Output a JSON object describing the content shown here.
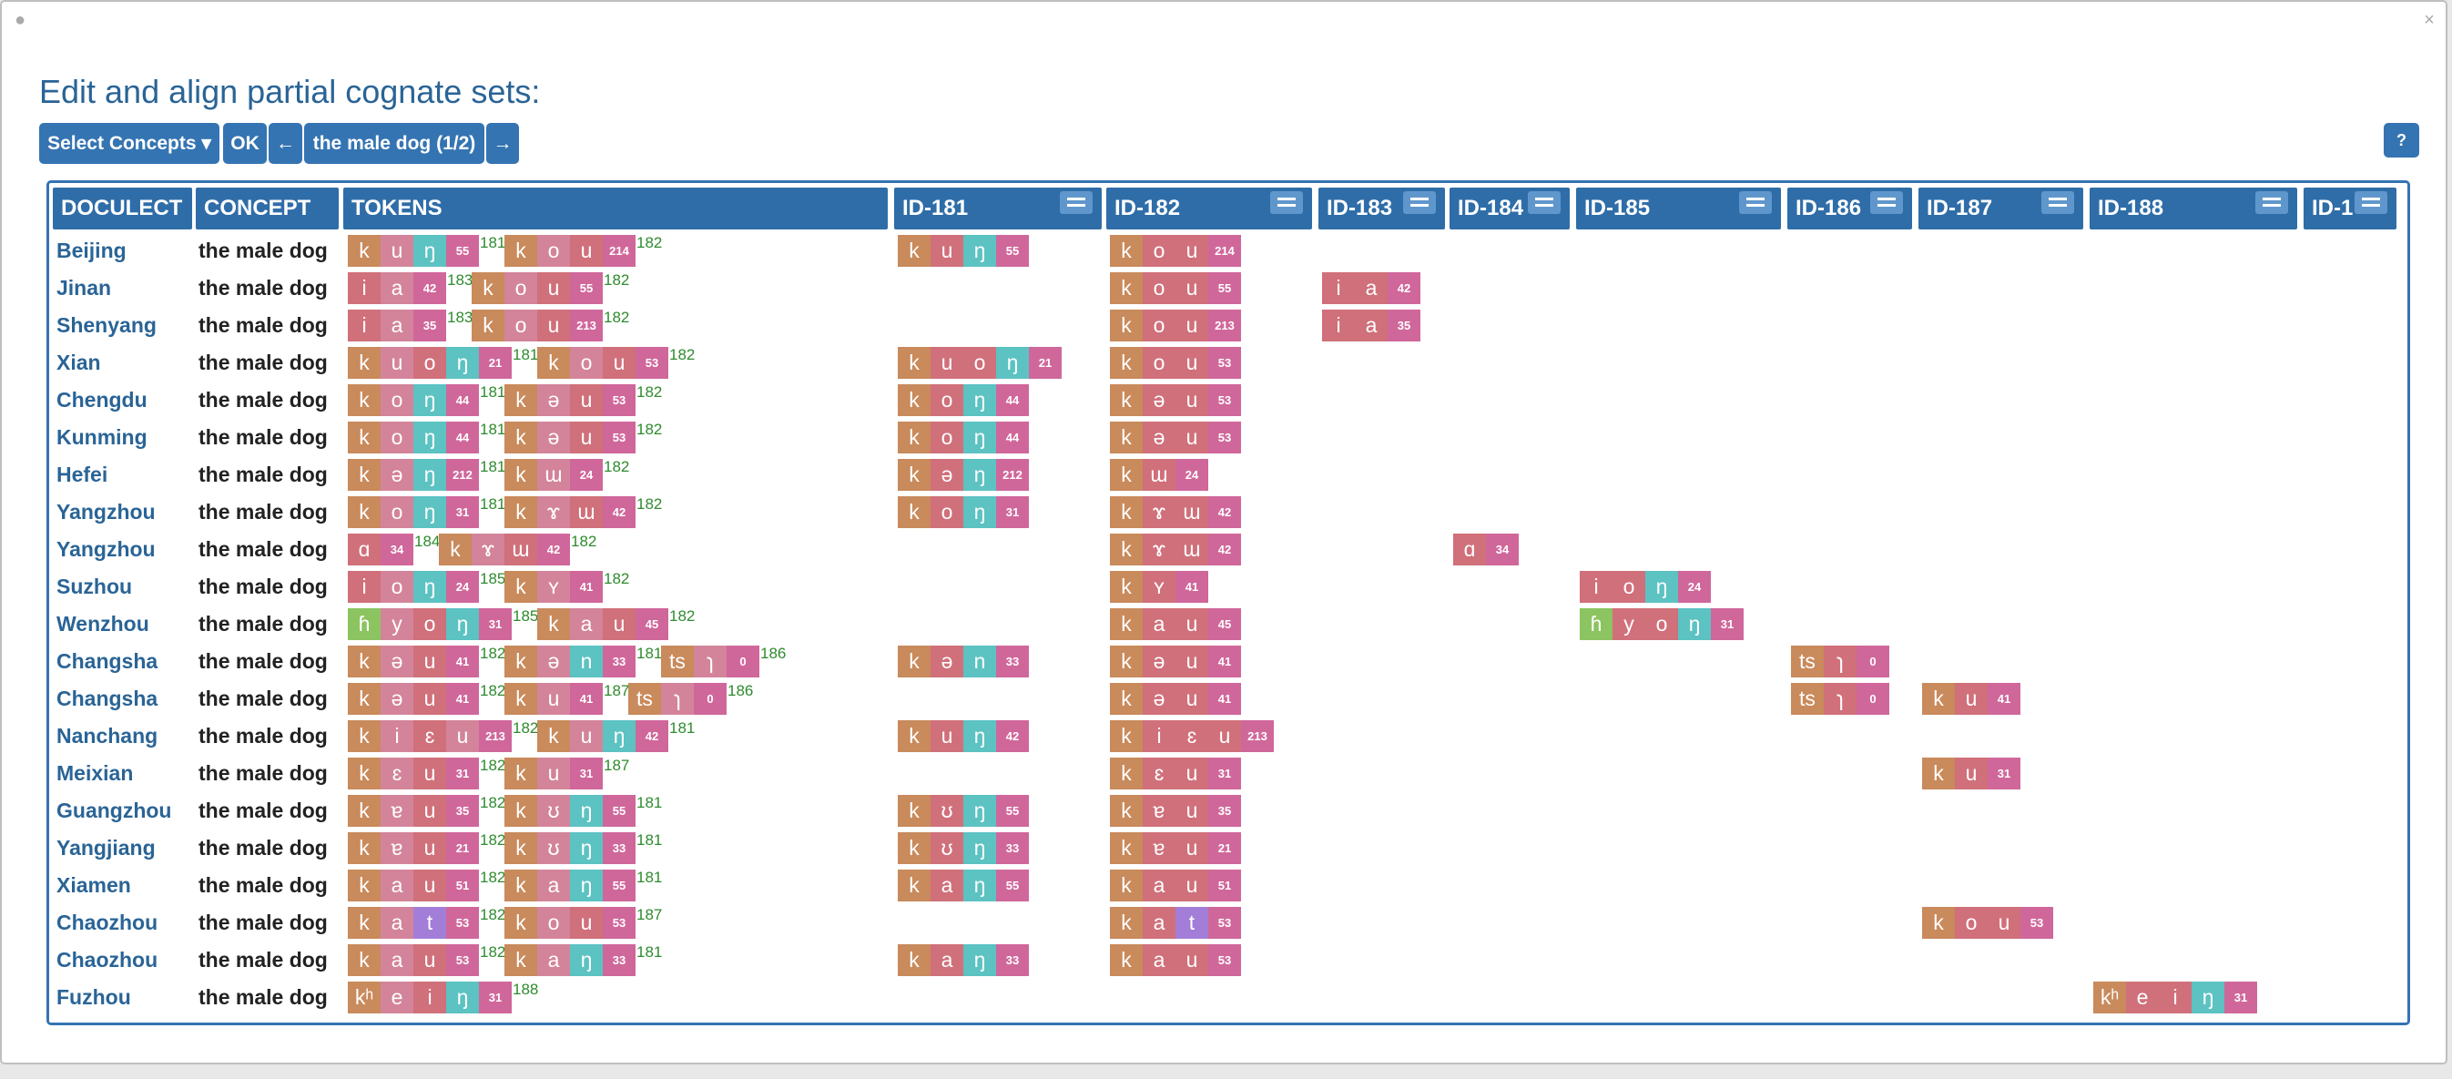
{
  "window": {
    "close_glyph": "×",
    "left_glyph": "●"
  },
  "title": "Edit and align partial cognate sets:",
  "toolbar": {
    "select_concepts": "Select Concepts ▾",
    "ok": "OK",
    "prev": "←",
    "current": "the male dog (1/2)",
    "next": "→",
    "help": "?"
  },
  "headers": [
    "DOCULECT",
    "CONCEPT",
    "TOKENS",
    "ID-181",
    "ID-182",
    "ID-183",
    "ID-184",
    "ID-185",
    "ID-186",
    "ID-187",
    "ID-188",
    "ID-1"
  ],
  "colors": {
    "consonant": "#c98a5c",
    "vowel": "#d0707a",
    "vowel_alt": "#d3849a",
    "nasal": "#5cc2c2",
    "tone": "#d0679a",
    "glottal": "#8bc460",
    "stop_t": "#a27ed8",
    "header": "#2f6da8",
    "button": "#3574b2"
  },
  "rows": [
    {
      "doculect": "Beijing",
      "concept": "the male dog",
      "morphemes": [
        {
          "tokens": [
            "k",
            "u",
            "ŋ",
            "55"
          ],
          "id": "181"
        },
        {
          "tokens": [
            "k",
            "o",
            "u",
            "214"
          ],
          "id": "182"
        }
      ],
      "cells": {
        "181": [
          "k",
          "u",
          "ŋ",
          "55"
        ],
        "182": [
          "k",
          "o",
          "u",
          "214"
        ]
      }
    },
    {
      "doculect": "Jinan",
      "concept": "the male dog",
      "morphemes": [
        {
          "tokens": [
            "i",
            "a",
            "42"
          ],
          "id": "183"
        },
        {
          "tokens": [
            "k",
            "o",
            "u",
            "55"
          ],
          "id": "182"
        }
      ],
      "cells": {
        "182": [
          "k",
          "o",
          "u",
          "55"
        ],
        "183": [
          "i",
          "a",
          "42"
        ]
      }
    },
    {
      "doculect": "Shenyang",
      "concept": "the male dog",
      "morphemes": [
        {
          "tokens": [
            "i",
            "a",
            "35"
          ],
          "id": "183"
        },
        {
          "tokens": [
            "k",
            "o",
            "u",
            "213"
          ],
          "id": "182"
        }
      ],
      "cells": {
        "182": [
          "k",
          "o",
          "u",
          "213"
        ],
        "183": [
          "i",
          "a",
          "35"
        ]
      }
    },
    {
      "doculect": "Xian",
      "concept": "the male dog",
      "morphemes": [
        {
          "tokens": [
            "k",
            "u",
            "o",
            "ŋ",
            "21"
          ],
          "id": "181"
        },
        {
          "tokens": [
            "k",
            "o",
            "u",
            "53"
          ],
          "id": "182"
        }
      ],
      "cells": {
        "181": [
          "k",
          "u",
          "o",
          "ŋ",
          "21"
        ],
        "182": [
          "k",
          "o",
          "u",
          "53"
        ]
      }
    },
    {
      "doculect": "Chengdu",
      "concept": "the male dog",
      "morphemes": [
        {
          "tokens": [
            "k",
            "o",
            "ŋ",
            "44"
          ],
          "id": "181"
        },
        {
          "tokens": [
            "k",
            "ə",
            "u",
            "53"
          ],
          "id": "182"
        }
      ],
      "cells": {
        "181": [
          "k",
          "o",
          "ŋ",
          "44"
        ],
        "182": [
          "k",
          "ə",
          "u",
          "53"
        ]
      }
    },
    {
      "doculect": "Kunming",
      "concept": "the male dog",
      "morphemes": [
        {
          "tokens": [
            "k",
            "o",
            "ŋ",
            "44"
          ],
          "id": "181"
        },
        {
          "tokens": [
            "k",
            "ə",
            "u",
            "53"
          ],
          "id": "182"
        }
      ],
      "cells": {
        "181": [
          "k",
          "o",
          "ŋ",
          "44"
        ],
        "182": [
          "k",
          "ə",
          "u",
          "53"
        ]
      }
    },
    {
      "doculect": "Hefei",
      "concept": "the male dog",
      "morphemes": [
        {
          "tokens": [
            "k",
            "ə",
            "ŋ",
            "212"
          ],
          "id": "181"
        },
        {
          "tokens": [
            "k",
            "ɯ",
            "24"
          ],
          "id": "182"
        }
      ],
      "cells": {
        "181": [
          "k",
          "ə",
          "ŋ",
          "212"
        ],
        "182": [
          "k",
          "ɯ",
          "24"
        ]
      }
    },
    {
      "doculect": "Yangzhou",
      "concept": "the male dog",
      "morphemes": [
        {
          "tokens": [
            "k",
            "o",
            "ŋ",
            "31"
          ],
          "id": "181"
        },
        {
          "tokens": [
            "k",
            "ɤ",
            "ɯ",
            "42"
          ],
          "id": "182"
        }
      ],
      "cells": {
        "181": [
          "k",
          "o",
          "ŋ",
          "31"
        ],
        "182": [
          "k",
          "ɤ",
          "ɯ",
          "42"
        ]
      }
    },
    {
      "doculect": "Yangzhou",
      "concept": "the male dog",
      "morphemes": [
        {
          "tokens": [
            "ɑ",
            "34"
          ],
          "id": "184"
        },
        {
          "tokens": [
            "k",
            "ɤ",
            "ɯ",
            "42"
          ],
          "id": "182"
        }
      ],
      "cells": {
        "182": [
          "k",
          "ɤ",
          "ɯ",
          "42"
        ],
        "184": [
          "ɑ",
          "34"
        ]
      }
    },
    {
      "doculect": "Suzhou",
      "concept": "the male dog",
      "morphemes": [
        {
          "tokens": [
            "i",
            "o",
            "ŋ",
            "24"
          ],
          "id": "185"
        },
        {
          "tokens": [
            "k",
            "ʏ",
            "41"
          ],
          "id": "182"
        }
      ],
      "cells": {
        "182": [
          "k",
          "ʏ",
          "41"
        ],
        "185": [
          "i",
          "o",
          "ŋ",
          "24"
        ]
      }
    },
    {
      "doculect": "Wenzhou",
      "concept": "the male dog",
      "morphemes": [
        {
          "tokens": [
            "ɦ",
            "y",
            "o",
            "ŋ",
            "31"
          ],
          "id": "185"
        },
        {
          "tokens": [
            "k",
            "a",
            "u",
            "45"
          ],
          "id": "182"
        }
      ],
      "cells": {
        "182": [
          "k",
          "a",
          "u",
          "45"
        ],
        "185": [
          "ɦ",
          "y",
          "o",
          "ŋ",
          "31"
        ]
      }
    },
    {
      "doculect": "Changsha",
      "concept": "the male dog",
      "morphemes": [
        {
          "tokens": [
            "k",
            "ə",
            "u",
            "41"
          ],
          "id": "182"
        },
        {
          "tokens": [
            "k",
            "ə",
            "n",
            "33"
          ],
          "id": "181"
        },
        {
          "tokens": [
            "ts",
            "ɿ",
            "0"
          ],
          "id": "186"
        }
      ],
      "cells": {
        "181": [
          "k",
          "ə",
          "n",
          "33"
        ],
        "182": [
          "k",
          "ə",
          "u",
          "41"
        ],
        "186": [
          "ts",
          "ɿ",
          "0"
        ]
      }
    },
    {
      "doculect": "Changsha",
      "concept": "the male dog",
      "morphemes": [
        {
          "tokens": [
            "k",
            "ə",
            "u",
            "41"
          ],
          "id": "182"
        },
        {
          "tokens": [
            "k",
            "u",
            "41"
          ],
          "id": "187"
        },
        {
          "tokens": [
            "ts",
            "ɿ",
            "0"
          ],
          "id": "186"
        }
      ],
      "cells": {
        "182": [
          "k",
          "ə",
          "u",
          "41"
        ],
        "186": [
          "ts",
          "ɿ",
          "0"
        ],
        "187": [
          "k",
          "u",
          "41"
        ]
      }
    },
    {
      "doculect": "Nanchang",
      "concept": "the male dog",
      "morphemes": [
        {
          "tokens": [
            "k",
            "i",
            "ɛ",
            "u",
            "213"
          ],
          "id": "182"
        },
        {
          "tokens": [
            "k",
            "u",
            "ŋ",
            "42"
          ],
          "id": "181"
        }
      ],
      "cells": {
        "181": [
          "k",
          "u",
          "ŋ",
          "42"
        ],
        "182": [
          "k",
          "i",
          "ɛ",
          "u",
          "213"
        ]
      }
    },
    {
      "doculect": "Meixian",
      "concept": "the male dog",
      "morphemes": [
        {
          "tokens": [
            "k",
            "ɛ",
            "u",
            "31"
          ],
          "id": "182"
        },
        {
          "tokens": [
            "k",
            "u",
            "31"
          ],
          "id": "187"
        }
      ],
      "cells": {
        "182": [
          "k",
          "ɛ",
          "u",
          "31"
        ],
        "187": [
          "k",
          "u",
          "31"
        ]
      }
    },
    {
      "doculect": "Guangzhou",
      "concept": "the male dog",
      "morphemes": [
        {
          "tokens": [
            "k",
            "ɐ",
            "u",
            "35"
          ],
          "id": "182"
        },
        {
          "tokens": [
            "k",
            "ʊ",
            "ŋ",
            "55"
          ],
          "id": "181"
        }
      ],
      "cells": {
        "181": [
          "k",
          "ʊ",
          "ŋ",
          "55"
        ],
        "182": [
          "k",
          "ɐ",
          "u",
          "35"
        ]
      }
    },
    {
      "doculect": "Yangjiang",
      "concept": "the male dog",
      "morphemes": [
        {
          "tokens": [
            "k",
            "ɐ",
            "u",
            "21"
          ],
          "id": "182"
        },
        {
          "tokens": [
            "k",
            "ʊ",
            "ŋ",
            "33"
          ],
          "id": "181"
        }
      ],
      "cells": {
        "181": [
          "k",
          "ʊ",
          "ŋ",
          "33"
        ],
        "182": [
          "k",
          "ɐ",
          "u",
          "21"
        ]
      }
    },
    {
      "doculect": "Xiamen",
      "concept": "the male dog",
      "morphemes": [
        {
          "tokens": [
            "k",
            "a",
            "u",
            "51"
          ],
          "id": "182"
        },
        {
          "tokens": [
            "k",
            "a",
            "ŋ",
            "55"
          ],
          "id": "181"
        }
      ],
      "cells": {
        "181": [
          "k",
          "a",
          "ŋ",
          "55"
        ],
        "182": [
          "k",
          "a",
          "u",
          "51"
        ]
      }
    },
    {
      "doculect": "Chaozhou",
      "concept": "the male dog",
      "morphemes": [
        {
          "tokens": [
            "k",
            "a",
            "t",
            "53"
          ],
          "id": "182"
        },
        {
          "tokens": [
            "k",
            "o",
            "u",
            "53"
          ],
          "id": "187"
        }
      ],
      "cells": {
        "182": [
          "k",
          "a",
          "t",
          "53"
        ],
        "187": [
          "k",
          "o",
          "u",
          "53"
        ]
      }
    },
    {
      "doculect": "Chaozhou",
      "concept": "the male dog",
      "morphemes": [
        {
          "tokens": [
            "k",
            "a",
            "u",
            "53"
          ],
          "id": "182"
        },
        {
          "tokens": [
            "k",
            "a",
            "ŋ",
            "33"
          ],
          "id": "181"
        }
      ],
      "cells": {
        "181": [
          "k",
          "a",
          "ŋ",
          "33"
        ],
        "182": [
          "k",
          "a",
          "u",
          "53"
        ]
      }
    },
    {
      "doculect": "Fuzhou",
      "concept": "the male dog",
      "morphemes": [
        {
          "tokens": [
            "kʰ",
            "e",
            "i",
            "ŋ",
            "31"
          ],
          "id": "188"
        }
      ],
      "cells": {
        "188": [
          "kʰ",
          "e",
          "i",
          "ŋ",
          "31"
        ]
      }
    }
  ]
}
